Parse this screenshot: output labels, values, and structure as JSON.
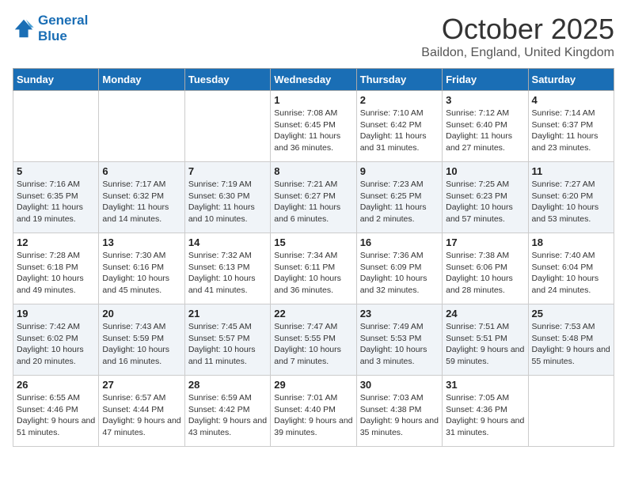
{
  "logo": {
    "line1": "General",
    "line2": "Blue"
  },
  "header": {
    "month": "October 2025",
    "location": "Baildon, England, United Kingdom"
  },
  "weekdays": [
    "Sunday",
    "Monday",
    "Tuesday",
    "Wednesday",
    "Thursday",
    "Friday",
    "Saturday"
  ],
  "weeks": [
    [
      {
        "day": "",
        "info": ""
      },
      {
        "day": "",
        "info": ""
      },
      {
        "day": "",
        "info": ""
      },
      {
        "day": "1",
        "info": "Sunrise: 7:08 AM\nSunset: 6:45 PM\nDaylight: 11 hours and 36 minutes."
      },
      {
        "day": "2",
        "info": "Sunrise: 7:10 AM\nSunset: 6:42 PM\nDaylight: 11 hours and 31 minutes."
      },
      {
        "day": "3",
        "info": "Sunrise: 7:12 AM\nSunset: 6:40 PM\nDaylight: 11 hours and 27 minutes."
      },
      {
        "day": "4",
        "info": "Sunrise: 7:14 AM\nSunset: 6:37 PM\nDaylight: 11 hours and 23 minutes."
      }
    ],
    [
      {
        "day": "5",
        "info": "Sunrise: 7:16 AM\nSunset: 6:35 PM\nDaylight: 11 hours and 19 minutes."
      },
      {
        "day": "6",
        "info": "Sunrise: 7:17 AM\nSunset: 6:32 PM\nDaylight: 11 hours and 14 minutes."
      },
      {
        "day": "7",
        "info": "Sunrise: 7:19 AM\nSunset: 6:30 PM\nDaylight: 11 hours and 10 minutes."
      },
      {
        "day": "8",
        "info": "Sunrise: 7:21 AM\nSunset: 6:27 PM\nDaylight: 11 hours and 6 minutes."
      },
      {
        "day": "9",
        "info": "Sunrise: 7:23 AM\nSunset: 6:25 PM\nDaylight: 11 hours and 2 minutes."
      },
      {
        "day": "10",
        "info": "Sunrise: 7:25 AM\nSunset: 6:23 PM\nDaylight: 10 hours and 57 minutes."
      },
      {
        "day": "11",
        "info": "Sunrise: 7:27 AM\nSunset: 6:20 PM\nDaylight: 10 hours and 53 minutes."
      }
    ],
    [
      {
        "day": "12",
        "info": "Sunrise: 7:28 AM\nSunset: 6:18 PM\nDaylight: 10 hours and 49 minutes."
      },
      {
        "day": "13",
        "info": "Sunrise: 7:30 AM\nSunset: 6:16 PM\nDaylight: 10 hours and 45 minutes."
      },
      {
        "day": "14",
        "info": "Sunrise: 7:32 AM\nSunset: 6:13 PM\nDaylight: 10 hours and 41 minutes."
      },
      {
        "day": "15",
        "info": "Sunrise: 7:34 AM\nSunset: 6:11 PM\nDaylight: 10 hours and 36 minutes."
      },
      {
        "day": "16",
        "info": "Sunrise: 7:36 AM\nSunset: 6:09 PM\nDaylight: 10 hours and 32 minutes."
      },
      {
        "day": "17",
        "info": "Sunrise: 7:38 AM\nSunset: 6:06 PM\nDaylight: 10 hours and 28 minutes."
      },
      {
        "day": "18",
        "info": "Sunrise: 7:40 AM\nSunset: 6:04 PM\nDaylight: 10 hours and 24 minutes."
      }
    ],
    [
      {
        "day": "19",
        "info": "Sunrise: 7:42 AM\nSunset: 6:02 PM\nDaylight: 10 hours and 20 minutes."
      },
      {
        "day": "20",
        "info": "Sunrise: 7:43 AM\nSunset: 5:59 PM\nDaylight: 10 hours and 16 minutes."
      },
      {
        "day": "21",
        "info": "Sunrise: 7:45 AM\nSunset: 5:57 PM\nDaylight: 10 hours and 11 minutes."
      },
      {
        "day": "22",
        "info": "Sunrise: 7:47 AM\nSunset: 5:55 PM\nDaylight: 10 hours and 7 minutes."
      },
      {
        "day": "23",
        "info": "Sunrise: 7:49 AM\nSunset: 5:53 PM\nDaylight: 10 hours and 3 minutes."
      },
      {
        "day": "24",
        "info": "Sunrise: 7:51 AM\nSunset: 5:51 PM\nDaylight: 9 hours and 59 minutes."
      },
      {
        "day": "25",
        "info": "Sunrise: 7:53 AM\nSunset: 5:48 PM\nDaylight: 9 hours and 55 minutes."
      }
    ],
    [
      {
        "day": "26",
        "info": "Sunrise: 6:55 AM\nSunset: 4:46 PM\nDaylight: 9 hours and 51 minutes."
      },
      {
        "day": "27",
        "info": "Sunrise: 6:57 AM\nSunset: 4:44 PM\nDaylight: 9 hours and 47 minutes."
      },
      {
        "day": "28",
        "info": "Sunrise: 6:59 AM\nSunset: 4:42 PM\nDaylight: 9 hours and 43 minutes."
      },
      {
        "day": "29",
        "info": "Sunrise: 7:01 AM\nSunset: 4:40 PM\nDaylight: 9 hours and 39 minutes."
      },
      {
        "day": "30",
        "info": "Sunrise: 7:03 AM\nSunset: 4:38 PM\nDaylight: 9 hours and 35 minutes."
      },
      {
        "day": "31",
        "info": "Sunrise: 7:05 AM\nSunset: 4:36 PM\nDaylight: 9 hours and 31 minutes."
      },
      {
        "day": "",
        "info": ""
      }
    ]
  ]
}
